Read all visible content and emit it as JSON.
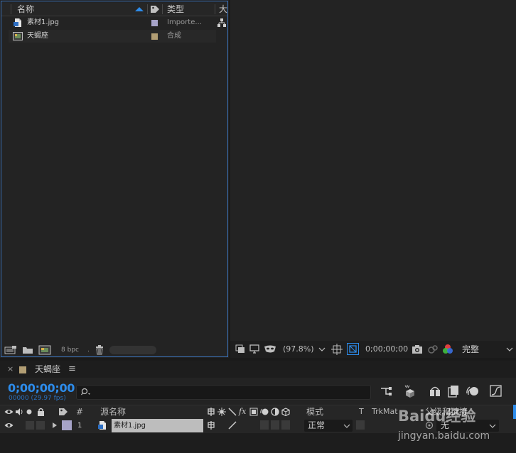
{
  "project": {
    "columns": {
      "name": "名称",
      "type": "类型",
      "size": "大"
    },
    "items": [
      {
        "name": "素材1.jpg",
        "type": "Importe...",
        "icon": "image-file-icon",
        "label_color": "#a6a3c8"
      },
      {
        "name": "天蝎座",
        "type": "合成",
        "icon": "composition-icon",
        "label_color": "#b29e74"
      }
    ],
    "footer": {
      "bpc": "8 bpc"
    }
  },
  "viewer": {
    "zoom": "(97.8%)",
    "timecode": "0;00;00;00",
    "resolution": "完整"
  },
  "timeline": {
    "comp_name": "天蝎座",
    "menu_icon": "≡",
    "timecode": "0;00;00;00",
    "frames": "00000 (29.97 fps)",
    "search_placeholder": "",
    "columns": {
      "num": "#",
      "source_name": "源名称",
      "mode": "模式",
      "t": "T",
      "trkmat": "TrkMat",
      "parent": "父级和链接"
    },
    "layer": {
      "index": "1",
      "name": "素材1.jpg",
      "mode": "正常",
      "parent": "无",
      "label_color": "#a6a3c8"
    }
  },
  "watermark": {
    "brand": "Baidu经验",
    "url": "jingyan.baidu.com"
  },
  "colors": {
    "accent": "#2d8ceb",
    "panel_border": "#3a6fb3"
  }
}
